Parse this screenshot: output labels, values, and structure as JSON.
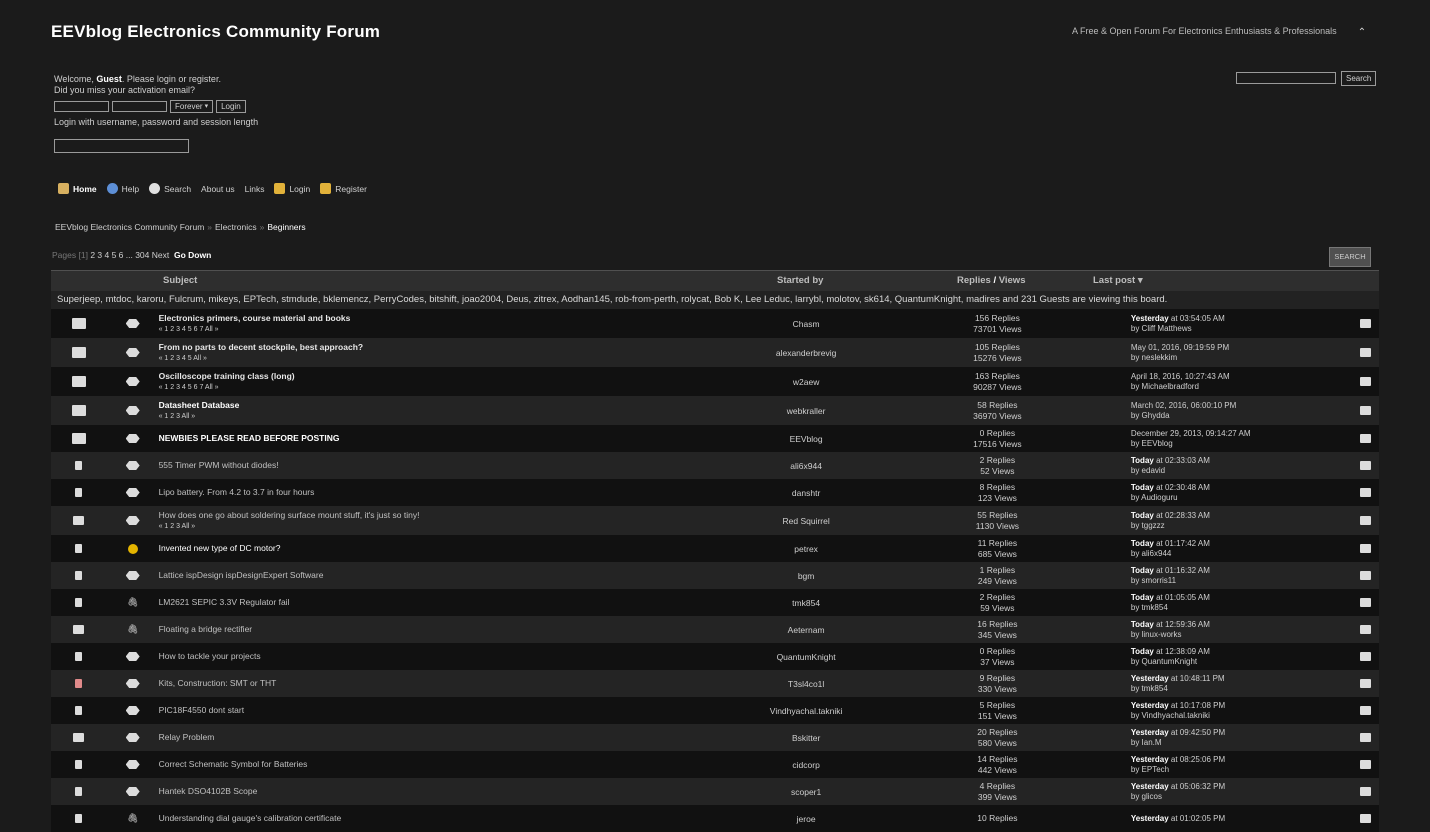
{
  "header": {
    "title": "EEVblog Electronics Community Forum",
    "tagline": "A Free & Open Forum For Electronics Enthusiasts & Professionals"
  },
  "user": {
    "welcome_prefix": "Welcome,",
    "guest": "Guest",
    "welcome_suffix": ". Please login or register.",
    "activation": "Did you miss your activation email?",
    "session_select": "Forever",
    "login_button": "Login",
    "login_note": "Login with username, password and session length"
  },
  "search": {
    "button": "Search",
    "topic_button": "SEARCH"
  },
  "menu": [
    {
      "label": "Home",
      "icon": "home-icon"
    },
    {
      "label": "Help",
      "icon": "help-icon"
    },
    {
      "label": "Search",
      "icon": "search-icon"
    },
    {
      "label": "About us",
      "icon": ""
    },
    {
      "label": "Links",
      "icon": ""
    },
    {
      "label": "Login",
      "icon": "key-icon"
    },
    {
      "label": "Register",
      "icon": "register-icon"
    }
  ],
  "breadcrumb": [
    "EEVblog Electronics Community Forum",
    "Electronics",
    "Beginners"
  ],
  "pagination": {
    "label": "Pages",
    "current": "[1]",
    "pages": "2 3 4 5 6 ... 304",
    "next": "Next",
    "go_down": "Go Down"
  },
  "table_header": {
    "subject": "Subject",
    "started_by": "Started by",
    "replies": "Replies",
    "views": "Views",
    "last_post": "Last post"
  },
  "viewers": "Superjeep, mtdoc, karoru, Fulcrum, mikeys, EPTech, stmdude, bklemencz, PerryCodes, bitshift, joao2004, Deus, zitrex, Aodhan145, rob-from-perth, rolycat, Bob K, Lee Leduc, larrybl, molotov, sk614, QuantumKnight, madires and 231 Guests are viewing this board.",
  "topics": [
    {
      "subject": "Electronics primers, course material and books",
      "type": "sticky",
      "pages": "« 1 2 3 4 5 6 7  All »",
      "starter": "Chasm",
      "replies": "156 Replies",
      "views": "73701 Views",
      "last_date": "Yesterday",
      "last_time": " at 03:54:05 AM",
      "last_by": "by Cliff Matthews"
    },
    {
      "subject": "From no parts to decent stockpile, best approach?",
      "type": "sticky",
      "pages": "« 1 2 3 4 5  All »",
      "starter": "alexanderbrevig",
      "replies": "105 Replies",
      "views": "15276 Views",
      "last_date": "",
      "last_time": "May 01, 2016, 09:19:59 PM",
      "last_by": "by neslekkim"
    },
    {
      "subject": "Oscilloscope training class (long)",
      "type": "sticky",
      "pages": "« 1 2 3 4 5 6 7  All »",
      "starter": "w2aew",
      "replies": "163 Replies",
      "views": "90287 Views",
      "last_date": "",
      "last_time": "April 18, 2016, 10:27:43 AM",
      "last_by": "by Michaelbradford"
    },
    {
      "subject": "Datasheet Database",
      "type": "locked",
      "pages": "« 1 2 3  All »",
      "starter": "webkraller",
      "replies": "58 Replies",
      "views": "36970 Views",
      "last_date": "",
      "last_time": "March 02, 2016, 06:00:10 PM",
      "last_by": "by Ghydda"
    },
    {
      "subject": "NEWBIES PLEASE READ BEFORE POSTING",
      "type": "locked",
      "pages": "",
      "starter": "EEVblog",
      "replies": "0 Replies",
      "views": "17516 Views",
      "last_date": "",
      "last_time": "December 29, 2013, 09:14:27 AM",
      "last_by": "by EEVblog"
    },
    {
      "subject": "555 Timer PWM without diodes!",
      "type": "normal",
      "pages": "",
      "starter": "ali6x944",
      "replies": "2 Replies",
      "views": "52 Views",
      "last_date": "Today",
      "last_time": " at 02:33:03 AM",
      "last_by": "by edavid"
    },
    {
      "subject": "Lipo battery. From 4.2 to 3.7 in four hours",
      "type": "normal",
      "pages": "",
      "starter": "danshtr",
      "replies": "8 Replies",
      "views": "123 Views",
      "last_date": "Today",
      "last_time": " at 02:30:48 AM",
      "last_by": "by Audioguru"
    },
    {
      "subject": "How does one go about soldering surface mount stuff, it's just so tiny!",
      "type": "normal",
      "pages": "« 1 2 3  All »",
      "starter": "Red Squirrel",
      "replies": "55 Replies",
      "views": "1130 Views",
      "last_date": "Today",
      "last_time": " at 02:28:33 AM",
      "last_by": "by tggzzz"
    },
    {
      "subject": "Invented new type of DC motor?",
      "type": "hot",
      "pages": "",
      "starter": "petrex",
      "replies": "11 Replies",
      "views": "685 Views",
      "last_date": "Today",
      "last_time": " at 01:17:42 AM",
      "last_by": "by ali6x944"
    },
    {
      "subject": "Lattice ispDesign ispDesignExpert Software",
      "type": "normal",
      "pages": "",
      "starter": "bgm",
      "replies": "1 Replies",
      "views": "249 Views",
      "last_date": "Today",
      "last_time": " at 01:16:32 AM",
      "last_by": "by smorris11"
    },
    {
      "subject": "LM2621 SEPIC 3.3V Regulator fail",
      "type": "normal",
      "pages": "",
      "starter": "tmk854",
      "replies": "2 Replies",
      "views": "59 Views",
      "last_date": "Today",
      "last_time": " at 01:05:05 AM",
      "last_by": "by tmk854"
    },
    {
      "subject": "Floating a bridge rectifier",
      "type": "normal",
      "pages": "",
      "starter": "Aeternam",
      "replies": "16 Replies",
      "views": "345 Views",
      "last_date": "Today",
      "last_time": " at 12:59:36 AM",
      "last_by": "by linux-works"
    },
    {
      "subject": "How to tackle your projects",
      "type": "normal",
      "pages": "",
      "starter": "QuantumKnight",
      "replies": "0 Replies",
      "views": "37 Views",
      "last_date": "Today",
      "last_time": " at 12:38:09 AM",
      "last_by": "by QuantumKnight"
    },
    {
      "subject": "Kits, Construction: SMT or THT",
      "type": "normal",
      "pages": "",
      "starter": "T3sl4co1l",
      "replies": "9 Replies",
      "views": "330 Views",
      "last_date": "Yesterday",
      "last_time": " at 10:48:11 PM",
      "last_by": "by tmk854"
    },
    {
      "subject": "PIC18F4550 dont start",
      "type": "normal",
      "pages": "",
      "starter": "Vindhyachal.takniki",
      "replies": "5 Replies",
      "views": "151 Views",
      "last_date": "Yesterday",
      "last_time": " at 10:17:08 PM",
      "last_by": "by Vindhyachal.takniki"
    },
    {
      "subject": "Relay Problem",
      "type": "normal",
      "pages": "",
      "starter": "Bskitter",
      "replies": "20 Replies",
      "views": "580 Views",
      "last_date": "Yesterday",
      "last_time": " at 09:42:50 PM",
      "last_by": "by Ian.M"
    },
    {
      "subject": "Correct Schematic Symbol for Batteries",
      "type": "normal",
      "pages": "",
      "starter": "cidcorp",
      "replies": "14 Replies",
      "views": "442 Views",
      "last_date": "Yesterday",
      "last_time": " at 08:25:06 PM",
      "last_by": "by EPTech"
    },
    {
      "subject": "Hantek DSO4102B Scope",
      "type": "normal",
      "pages": "",
      "starter": "scoper1",
      "replies": "4 Replies",
      "views": "399 Views",
      "last_date": "Yesterday",
      "last_time": " at 05:06:32 PM",
      "last_by": "by glicos"
    },
    {
      "subject": "Understanding dial gauge's calibration certificate",
      "type": "normal",
      "pages": "",
      "starter": "jeroe",
      "replies": "10 Replies",
      "views": "",
      "last_date": "Yesterday",
      "last_time": " at 01:02:05 PM",
      "last_by": ""
    }
  ],
  "row_icons": [
    "sticky",
    "sticky",
    "sticky",
    "sticky",
    "locked",
    "normal-small",
    "normal-small",
    "multi",
    "normal-small",
    "normal-small",
    "normal-small",
    "multi",
    "normal-small",
    "hot-small",
    "normal-small",
    "multi",
    "normal-small",
    "normal-small",
    "normal-small"
  ],
  "msg_icons": [
    "xx",
    "xx",
    "xx",
    "xx",
    "xx",
    "xx",
    "xx",
    "xx",
    "smiley",
    "xx",
    "clip",
    "clip",
    "xx",
    "xx",
    "xx",
    "xx",
    "xx",
    "xx",
    "clip"
  ]
}
